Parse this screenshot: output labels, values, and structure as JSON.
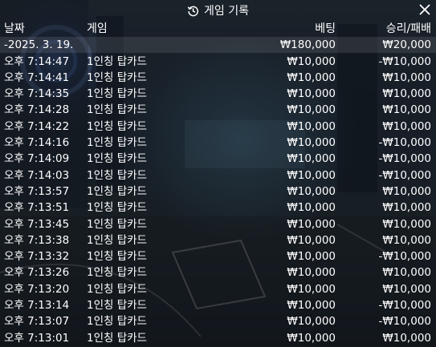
{
  "title": "게임 기록",
  "columns": {
    "date": "날짜",
    "game": "게임",
    "bet": "베팅",
    "winloss": "승리/패배"
  },
  "summary": {
    "date": "-2025. 3. 19.",
    "game": "",
    "bet": "₩180,000",
    "winloss": "₩20,000"
  },
  "rows": [
    {
      "time": "오후 7:14:47",
      "game": "1인칭 탑카드",
      "bet": "₩10,000",
      "result": "-₩10,000"
    },
    {
      "time": "오후 7:14:41",
      "game": "1인칭 탑카드",
      "bet": "₩10,000",
      "result": "₩10,000"
    },
    {
      "time": "오후 7:14:35",
      "game": "1인칭 탑카드",
      "bet": "₩10,000",
      "result": "₩10,000"
    },
    {
      "time": "오후 7:14:28",
      "game": "1인칭 탑카드",
      "bet": "₩10,000",
      "result": "₩10,000"
    },
    {
      "time": "오후 7:14:22",
      "game": "1인칭 탑카드",
      "bet": "₩10,000",
      "result": "₩10,000"
    },
    {
      "time": "오후 7:14:16",
      "game": "1인칭 탑카드",
      "bet": "₩10,000",
      "result": "-₩10,000"
    },
    {
      "time": "오후 7:14:09",
      "game": "1인칭 탑카드",
      "bet": "₩10,000",
      "result": "-₩10,000"
    },
    {
      "time": "오후 7:14:03",
      "game": "1인칭 탑카드",
      "bet": "₩10,000",
      "result": "-₩10,000"
    },
    {
      "time": "오후 7:13:57",
      "game": "1인칭 탑카드",
      "bet": "₩10,000",
      "result": "₩10,000"
    },
    {
      "time": "오후 7:13:51",
      "game": "1인칭 탑카드",
      "bet": "₩10,000",
      "result": "₩10,000"
    },
    {
      "time": "오후 7:13:45",
      "game": "1인칭 탑카드",
      "bet": "₩10,000",
      "result": "₩10,000"
    },
    {
      "time": "오후 7:13:38",
      "game": "1인칭 탑카드",
      "bet": "₩10,000",
      "result": "₩10,000"
    },
    {
      "time": "오후 7:13:32",
      "game": "1인칭 탑카드",
      "bet": "₩10,000",
      "result": "-₩10,000"
    },
    {
      "time": "오후 7:13:26",
      "game": "1인칭 탑카드",
      "bet": "₩10,000",
      "result": "₩10,000"
    },
    {
      "time": "오후 7:13:20",
      "game": "1인칭 탑카드",
      "bet": "₩10,000",
      "result": "₩10,000"
    },
    {
      "time": "오후 7:13:14",
      "game": "1인칭 탑카드",
      "bet": "₩10,000",
      "result": "-₩10,000"
    },
    {
      "time": "오후 7:13:07",
      "game": "1인칭 탑카드",
      "bet": "₩10,000",
      "result": "-₩10,000"
    },
    {
      "time": "오후 7:13:01",
      "game": "1인칭 탑카드",
      "bet": "₩10,000",
      "result": "₩10,000"
    }
  ],
  "icons": {
    "title": "history-icon",
    "close": "close-icon"
  }
}
